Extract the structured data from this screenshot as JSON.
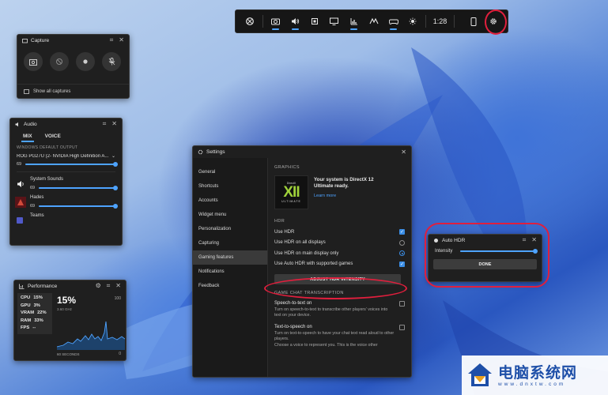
{
  "game_bar": {
    "time": "1:28",
    "items": [
      {
        "icon": "xbox-icon",
        "active": false
      },
      {
        "icon": "capture-widget-icon",
        "active": true
      },
      {
        "icon": "audio-icon",
        "active": true
      },
      {
        "icon": "resources-icon",
        "active": false
      },
      {
        "icon": "capture-display-icon",
        "active": false
      },
      {
        "icon": "performance-icon",
        "active": true
      },
      {
        "icon": "achievements-icon",
        "active": false
      },
      {
        "icon": "controller-icon",
        "active": true
      },
      {
        "icon": "brightness-icon",
        "active": false
      }
    ],
    "highlight_color": "#e01f3d"
  },
  "capture": {
    "title": "Capture",
    "show_all": "Show all captures"
  },
  "audio": {
    "title": "Audio",
    "tabs": [
      "MIX",
      "VOICE"
    ],
    "default_output_label": "WINDOWS DEFAULT OUTPUT",
    "device": "ROG PG27U (2- NVIDIA High Definition A...",
    "master_volume": "69",
    "apps": [
      {
        "name": "System Sounds",
        "volume": "69"
      },
      {
        "name": "Hades",
        "volume": "69"
      },
      {
        "name": "Teams",
        "volume": ""
      }
    ]
  },
  "performance": {
    "title": "Performance",
    "stats": [
      {
        "label": "CPU",
        "value": "15%"
      },
      {
        "label": "GPU",
        "value": "3%"
      },
      {
        "label": "VRAM",
        "value": "22%"
      },
      {
        "label": "RAM",
        "value": "33%"
      },
      {
        "label": "FPS",
        "value": "--"
      }
    ],
    "big_value": "15%",
    "sub": "3.60 GHz",
    "max_label": "100",
    "min_label": "0",
    "window_label": "60 SECONDS"
  },
  "settings": {
    "title": "Settings",
    "nav": [
      "General",
      "Shortcuts",
      "Accounts",
      "Widget menu",
      "Personalization",
      "Capturing",
      "Gaming features",
      "Notifications",
      "Feedback"
    ],
    "active_nav": "Gaming features",
    "graphics_head": "GRAPHICS",
    "dx_logo": {
      "top": "DirectX",
      "numeral": "XII",
      "bottom": "ULTIMATE"
    },
    "dx_text": "Your system is DirectX 12 Ultimate ready.",
    "dx_link": "Learn more",
    "hdr_head": "HDR",
    "hdr_options": [
      {
        "label": "Use HDR",
        "control": "checkbox",
        "on": true
      },
      {
        "label": "Use HDR on all displays",
        "control": "radio",
        "on": false
      },
      {
        "label": "Use HDR on main display only",
        "control": "radio",
        "on": true
      },
      {
        "label": "Use Auto HDR with supported games",
        "control": "checkbox",
        "on": true
      }
    ],
    "adjust_button": "ADJUST HDR INTENSITY",
    "transcription_head": "GAME CHAT TRANSCRIPTION",
    "speech_to_text": {
      "title": "Speech-to-text on",
      "desc": "Turn on speech-to-text to transcribe other players' voices into text on your device."
    },
    "text_to_speech": {
      "title": "Text-to-speech on",
      "desc": "Turn on text-to-speech to have your chat text read aloud to other players.",
      "desc2": "Choose a voice to represent you. This is the voice other"
    }
  },
  "auto_hdr": {
    "title": "Auto HDR",
    "intensity_label": "Intensity",
    "intensity_fraction": 1.0,
    "done": "DONE"
  },
  "watermark": {
    "name": "电脑系统网",
    "url": "www.dnxtw.com"
  }
}
